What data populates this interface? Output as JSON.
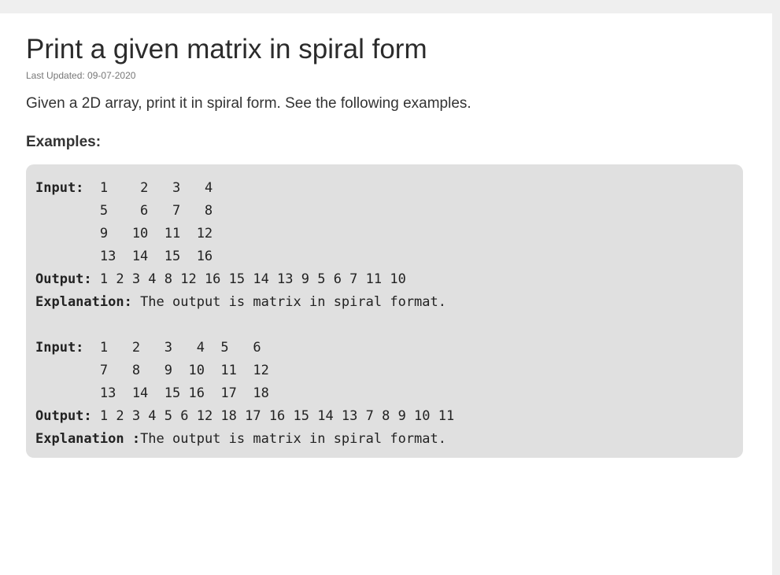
{
  "article": {
    "title": "Print a given matrix in spiral form",
    "updated": "Last Updated: 09-07-2020",
    "intro": "Given a 2D array, print it in spiral form. See the following examples.",
    "examples_label": "Examples:"
  },
  "code": {
    "lines": [
      {
        "label": "Input:",
        "text": "  1    2   3   4"
      },
      {
        "label": "",
        "text": "        5    6   7   8"
      },
      {
        "label": "",
        "text": "        9   10  11  12"
      },
      {
        "label": "",
        "text": "        13  14  15  16"
      },
      {
        "label": "Output:",
        "text": " 1 2 3 4 8 12 16 15 14 13 9 5 6 7 11 10"
      },
      {
        "label": "Explanation:",
        "text": " The output is matrix in spiral format."
      },
      {
        "label": "",
        "text": ""
      },
      {
        "label": "Input:",
        "text": "  1   2   3   4  5   6"
      },
      {
        "label": "",
        "text": "        7   8   9  10  11  12"
      },
      {
        "label": "",
        "text": "        13  14  15 16  17  18"
      },
      {
        "label": "Output:",
        "text": " 1 2 3 4 5 6 12 18 17 16 15 14 13 7 8 9 10 11"
      },
      {
        "label": "Explanation :",
        "text": "The output is matrix in spiral format."
      }
    ]
  }
}
